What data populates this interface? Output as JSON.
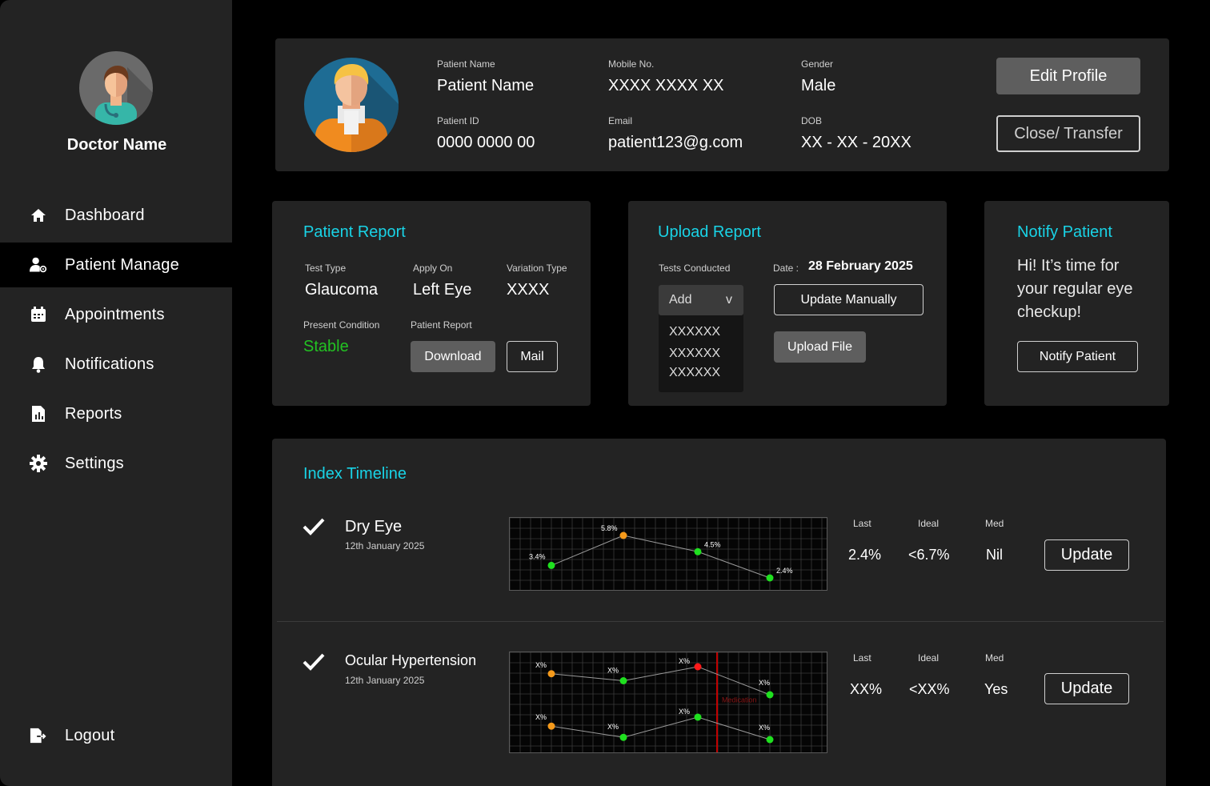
{
  "sidebar": {
    "doctor_name": "Doctor Name",
    "items": [
      {
        "label": "Dashboard",
        "icon": "home-icon"
      },
      {
        "label": "Patient Manage",
        "icon": "patient-manage-icon"
      },
      {
        "label": "Appointments",
        "icon": "calendar-icon"
      },
      {
        "label": "Notifications",
        "icon": "bell-icon"
      },
      {
        "label": "Reports",
        "icon": "report-icon"
      },
      {
        "label": "Settings",
        "icon": "gear-icon"
      }
    ],
    "active_item": "Patient Manage",
    "logout_label": "Logout"
  },
  "profile": {
    "patient_name_label": "Patient Name",
    "patient_name": "Patient Name",
    "mobile_label": "Mobile No.",
    "mobile": "XXXX XXXX XX",
    "gender_label": "Gender",
    "gender": "Male",
    "patient_id_label": "Patient ID",
    "patient_id": "0000 0000 00",
    "email_label": "Email",
    "email": "patient123@g.com",
    "dob_label": "DOB",
    "dob": "XX - XX - 20XX",
    "edit_button": "Edit Profile",
    "close_button": "Close/ Transfer"
  },
  "patient_report": {
    "title": "Patient Report",
    "test_type_label": "Test Type",
    "test_type": "Glaucoma",
    "apply_on_label": "Apply On",
    "apply_on": "Left Eye",
    "variation_label": "Variation Type",
    "variation": "XXXX",
    "condition_label": "Present Condition",
    "condition": "Stable",
    "report_label": "Patient Report",
    "download_button": "Download",
    "mail_button": "Mail"
  },
  "upload_report": {
    "title": "Upload Report",
    "tests_label": "Tests Conducted",
    "date_label": "Date :",
    "date": "28 February 2025",
    "dropdown_value": "Add",
    "dropdown_arrow": "v",
    "options": [
      "XXXXXX",
      "XXXXXX",
      "XXXXXX"
    ],
    "update_manually_button": "Update Manually",
    "upload_file_button": "Upload File"
  },
  "notify": {
    "title": "Notify Patient",
    "message": "Hi! It’s time for your regular eye checkup!",
    "button": "Notify Patient"
  },
  "timeline": {
    "title": "Index Timeline",
    "entries": [
      {
        "name": "Dry Eye",
        "date": "12th January 2025",
        "last_label": "Last",
        "last": "2.4%",
        "ideal_label": "Ideal",
        "ideal": "<6.7%",
        "med_label": "Med",
        "med": "Nil",
        "update_button": "Update"
      },
      {
        "name": "Ocular Hypertension",
        "date": "12th January 2025",
        "last_label": "Last",
        "last": "XX%",
        "ideal_label": "Ideal",
        "ideal": "<XX%",
        "med_label": "Med",
        "med": "Yes",
        "update_button": "Update"
      }
    ]
  },
  "chart_data": [
    {
      "type": "line",
      "series": [
        {
          "values": [
            3.4,
            5.8,
            4.5,
            2.4
          ],
          "labels": [
            "3.4%",
            "5.8%",
            "4.5%",
            "2.4%"
          ],
          "point_colors": [
            "#1fe01f",
            "#f59a1b",
            "#1fe01f",
            "#1fe01f"
          ]
        }
      ],
      "grid": true
    },
    {
      "type": "line",
      "series": [
        {
          "values": [
            4.6,
            4.0,
            5.2,
            2.8
          ],
          "labels": [
            "X%",
            "X%",
            "X%",
            "X%"
          ],
          "point_colors": [
            "#f59a1b",
            "#1fe01f",
            "#ff1a1a",
            "#1fe01f"
          ]
        },
        {
          "values": [
            1.6,
            0.6,
            2.4,
            0.4
          ],
          "labels": [
            "X%",
            "X%",
            "X%",
            "X%"
          ],
          "point_colors": [
            "#f59a1b",
            "#1fe01f",
            "#1fe01f",
            "#1fe01f"
          ]
        }
      ],
      "marker": {
        "label": "Medication",
        "color": "#c00000"
      },
      "grid": true
    }
  ],
  "colors": {
    "accent": "#19d3e6",
    "stable": "#22c322",
    "panel": "#232323"
  }
}
